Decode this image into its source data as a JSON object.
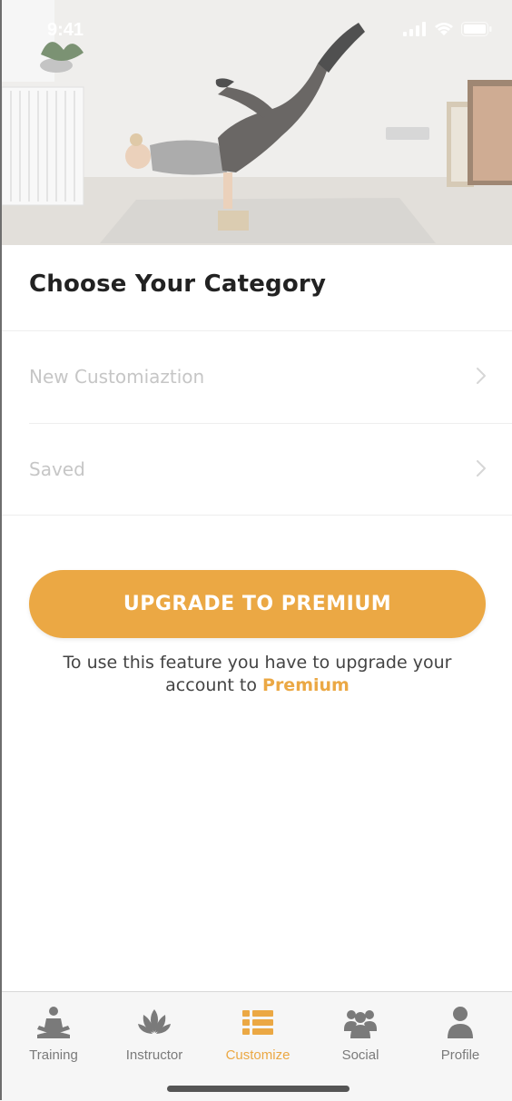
{
  "status_bar": {
    "time": "9:41"
  },
  "page": {
    "title": "Choose Your Category"
  },
  "categories": [
    {
      "label": "New Customiaztion"
    },
    {
      "label": "Saved"
    }
  ],
  "upgrade": {
    "button_label": "UPGRADE TO PREMIUM",
    "note_prefix": "To use this feature you have to upgrade your account to",
    "note_accent": "Premium"
  },
  "tabs": [
    {
      "label": "Training",
      "icon": "meditation-icon",
      "active": false
    },
    {
      "label": "Instructor",
      "icon": "lotus-icon",
      "active": false
    },
    {
      "label": "Customize",
      "icon": "list-icon",
      "active": true
    },
    {
      "label": "Social",
      "icon": "group-icon",
      "active": false
    },
    {
      "label": "Profile",
      "icon": "person-icon",
      "active": false
    }
  ],
  "colors": {
    "accent": "#eba844",
    "tab_inactive": "#7a7a7a",
    "title": "#222222",
    "muted": "#c6c6c6"
  }
}
